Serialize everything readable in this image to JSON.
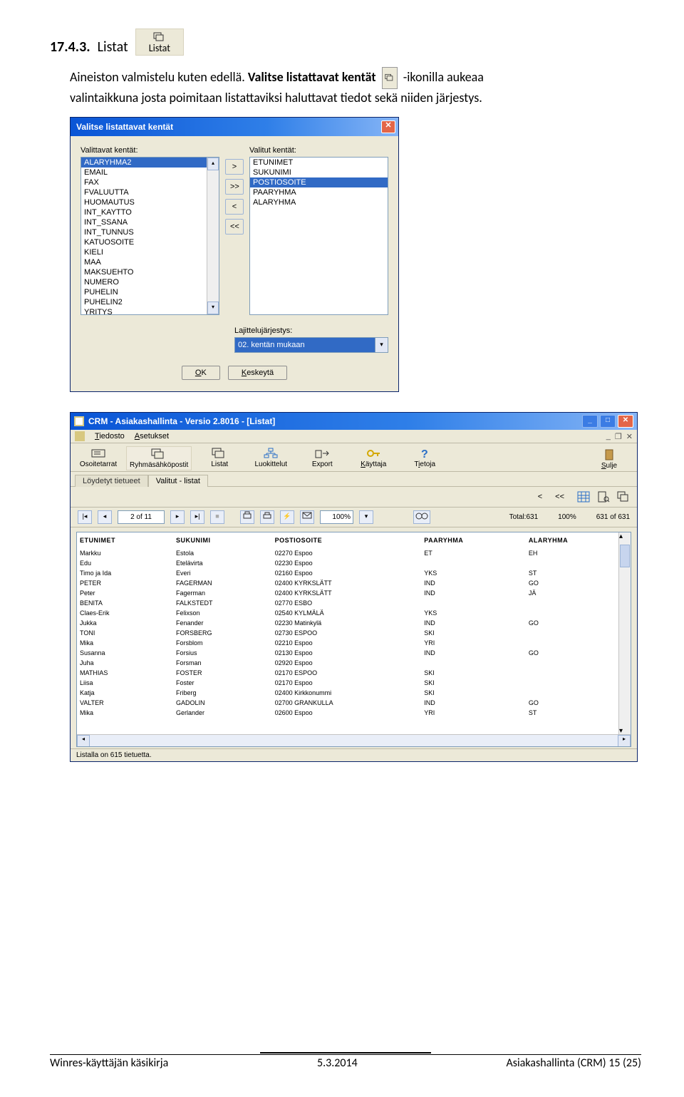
{
  "section": {
    "number": "17.4.3.",
    "title": "Listat"
  },
  "chip": {
    "label": "Listat"
  },
  "body": {
    "line1": "Aineiston valmistelu kuten edellä. ",
    "bold": "Valitse listattavat kentät ",
    "after_icon": "-ikonilla aukeaa",
    "line2": "valintaikkuna josta poimitaan listattaviksi haluttavat tiedot sekä niiden järjestys."
  },
  "dialog": {
    "title": "Valitse listattavat kentät",
    "left_label": "Valittavat kentät:",
    "right_label": "Valitut kentät:",
    "left_items": [
      "ALARYHMA2",
      "EMAIL",
      "FAX",
      "FVALUUTTA",
      "HUOMAUTUS",
      "INT_KAYTTO",
      "INT_SSANA",
      "INT_TUNNUS",
      "KATUOSOITE",
      "KIELI",
      "MAA",
      "MAKSUEHTO",
      "NUMERO",
      "PUHELIN",
      "PUHELIN2",
      "YRITYS"
    ],
    "left_selected": "ALARYHMA2",
    "right_items": [
      "ETUNIMET",
      "SUKUNIMI",
      "POSTIOSOITE",
      "PAARYHMA",
      "ALARYHMA"
    ],
    "right_selected": "POSTIOSOITE",
    "btn_add": ">",
    "btn_addall": ">>",
    "btn_rem": "<",
    "btn_remall": "<<",
    "sort_label": "Lajittelujärjestys:",
    "sort_value": "02. kentän mukaan",
    "ok": "OK",
    "cancel": "Keskeytä"
  },
  "crm": {
    "title": "CRM - Asiakashallinta - Versio 2.8016 - [Listat]",
    "menus": {
      "file": "Tiedosto",
      "settings": "Asetukset"
    },
    "toolbar": {
      "osoite": "Osoitetarrat",
      "ryhma": "Ryhmäsähköpostit",
      "listat": "Listat",
      "luok": "Luokittelut",
      "export": "Export",
      "kayttaja": "Käyttaja",
      "tietoja": "Tietoja",
      "sulje": "Sulje"
    },
    "tabs": {
      "t1": "Löydetyt tietueet",
      "t2": "Valitut - listat"
    },
    "tabrow2": {
      "lt": "<",
      "ltlt": "<<"
    },
    "nav": {
      "page": "2 of 11",
      "zoom": "100%",
      "total": "Total:631",
      "pct": "100%",
      "of": "631 of 631"
    },
    "columns": [
      "ETUNIMET",
      "SUKUNIMI",
      "POSTIOSOITE",
      "PAARYHMA",
      "ALARYHMA"
    ],
    "rows": [
      [
        "Markku",
        "Estola",
        "02270 Espoo",
        "ET",
        "EH"
      ],
      [
        "Edu",
        "Etelävirta",
        "02230 Espoo",
        "",
        ""
      ],
      [
        "Timo ja Ida",
        "Everi",
        "02160 Espoo",
        "YKS",
        "ST"
      ],
      [
        "PETER",
        "FAGERMAN",
        "02400 KYRKSLÄTT",
        "IND",
        "GO"
      ],
      [
        "Peter",
        "Fagerman",
        "02400 KYRKSLÄTT",
        "IND",
        "JÄ"
      ],
      [
        "BENITA",
        "FALKSTEDT",
        "02770 ESBO",
        "",
        ""
      ],
      [
        "Claes-Erik",
        "Felixson",
        "02540 KYLMÄLÄ",
        "YKS",
        ""
      ],
      [
        "Jukka",
        "Fenander",
        "02230 Matinkylä",
        "IND",
        "GO"
      ],
      [
        "TONI",
        "FORSBERG",
        "02730 ESPOO",
        "SKI",
        ""
      ],
      [
        "Mika",
        "Forsblom",
        "02210 Espoo",
        "YRI",
        ""
      ],
      [
        "Susanna",
        "Forsius",
        "02130 Espoo",
        "IND",
        "GO"
      ],
      [
        "Juha",
        "Forsman",
        "02920 Espoo",
        "",
        ""
      ],
      [
        "MATHIAS",
        "FOSTER",
        "02170 ESPOO",
        "SKI",
        ""
      ],
      [
        "Liisa",
        "Foster",
        "02170 Espoo",
        "SKI",
        ""
      ],
      [
        "Katja",
        "Friberg",
        "02400 Kirkkonummi",
        "SKI",
        ""
      ],
      [
        "VALTER",
        "GADOLIN",
        "02700 GRANKULLA",
        "IND",
        "GO"
      ],
      [
        "Mika",
        "Gerlander",
        "02600 Espoo",
        "YRI",
        "ST"
      ]
    ],
    "status": "Listalla on 615 tietuetta."
  },
  "footer": {
    "left": "Winres-käyttäjän käsikirja",
    "mid": "5.3.2014",
    "right": "Asiakashallinta (CRM)  15 (25)"
  }
}
